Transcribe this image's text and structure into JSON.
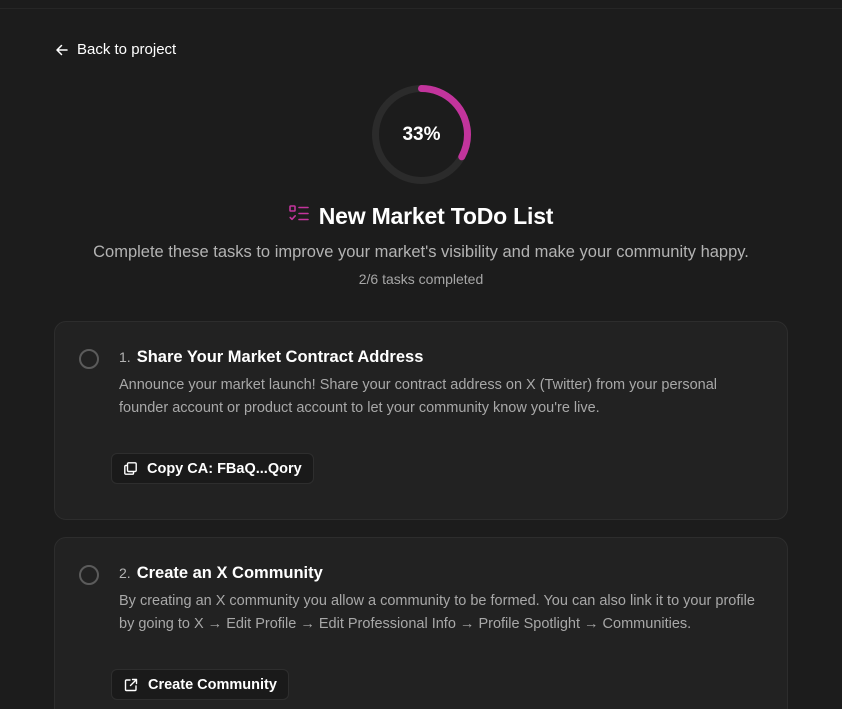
{
  "nav": {
    "back_label": "Back to project"
  },
  "progress": {
    "percent_label": "33%",
    "fraction": 0.33,
    "accent_color": "#c2349c",
    "track_color": "#2b2b2b"
  },
  "header": {
    "title": "New Market ToDo List",
    "icon": "checklist-icon",
    "subtitle": "Complete these tasks to improve your market's visibility and make your community happy.",
    "tasks_completed": "2/6 tasks completed"
  },
  "tasks": [
    {
      "number": "1.",
      "title": "Share Your Market Contract Address",
      "description": "Announce your market launch! Share your contract address on X (Twitter) from your personal founder account or product account to let your community know you're live.",
      "action_label": "Copy CA: FBaQ...Qory",
      "action_icon": "copy-icon",
      "completed": false
    },
    {
      "number": "2.",
      "title": "Create an X Community",
      "description": "By creating an X community you allow a community to be formed. You can also link it to your profile by going to X → Edit Profile → Edit Professional Info → Profile Spotlight → Communities.",
      "action_label": "Create Community",
      "action_icon": "external-link-icon",
      "completed": false
    }
  ]
}
